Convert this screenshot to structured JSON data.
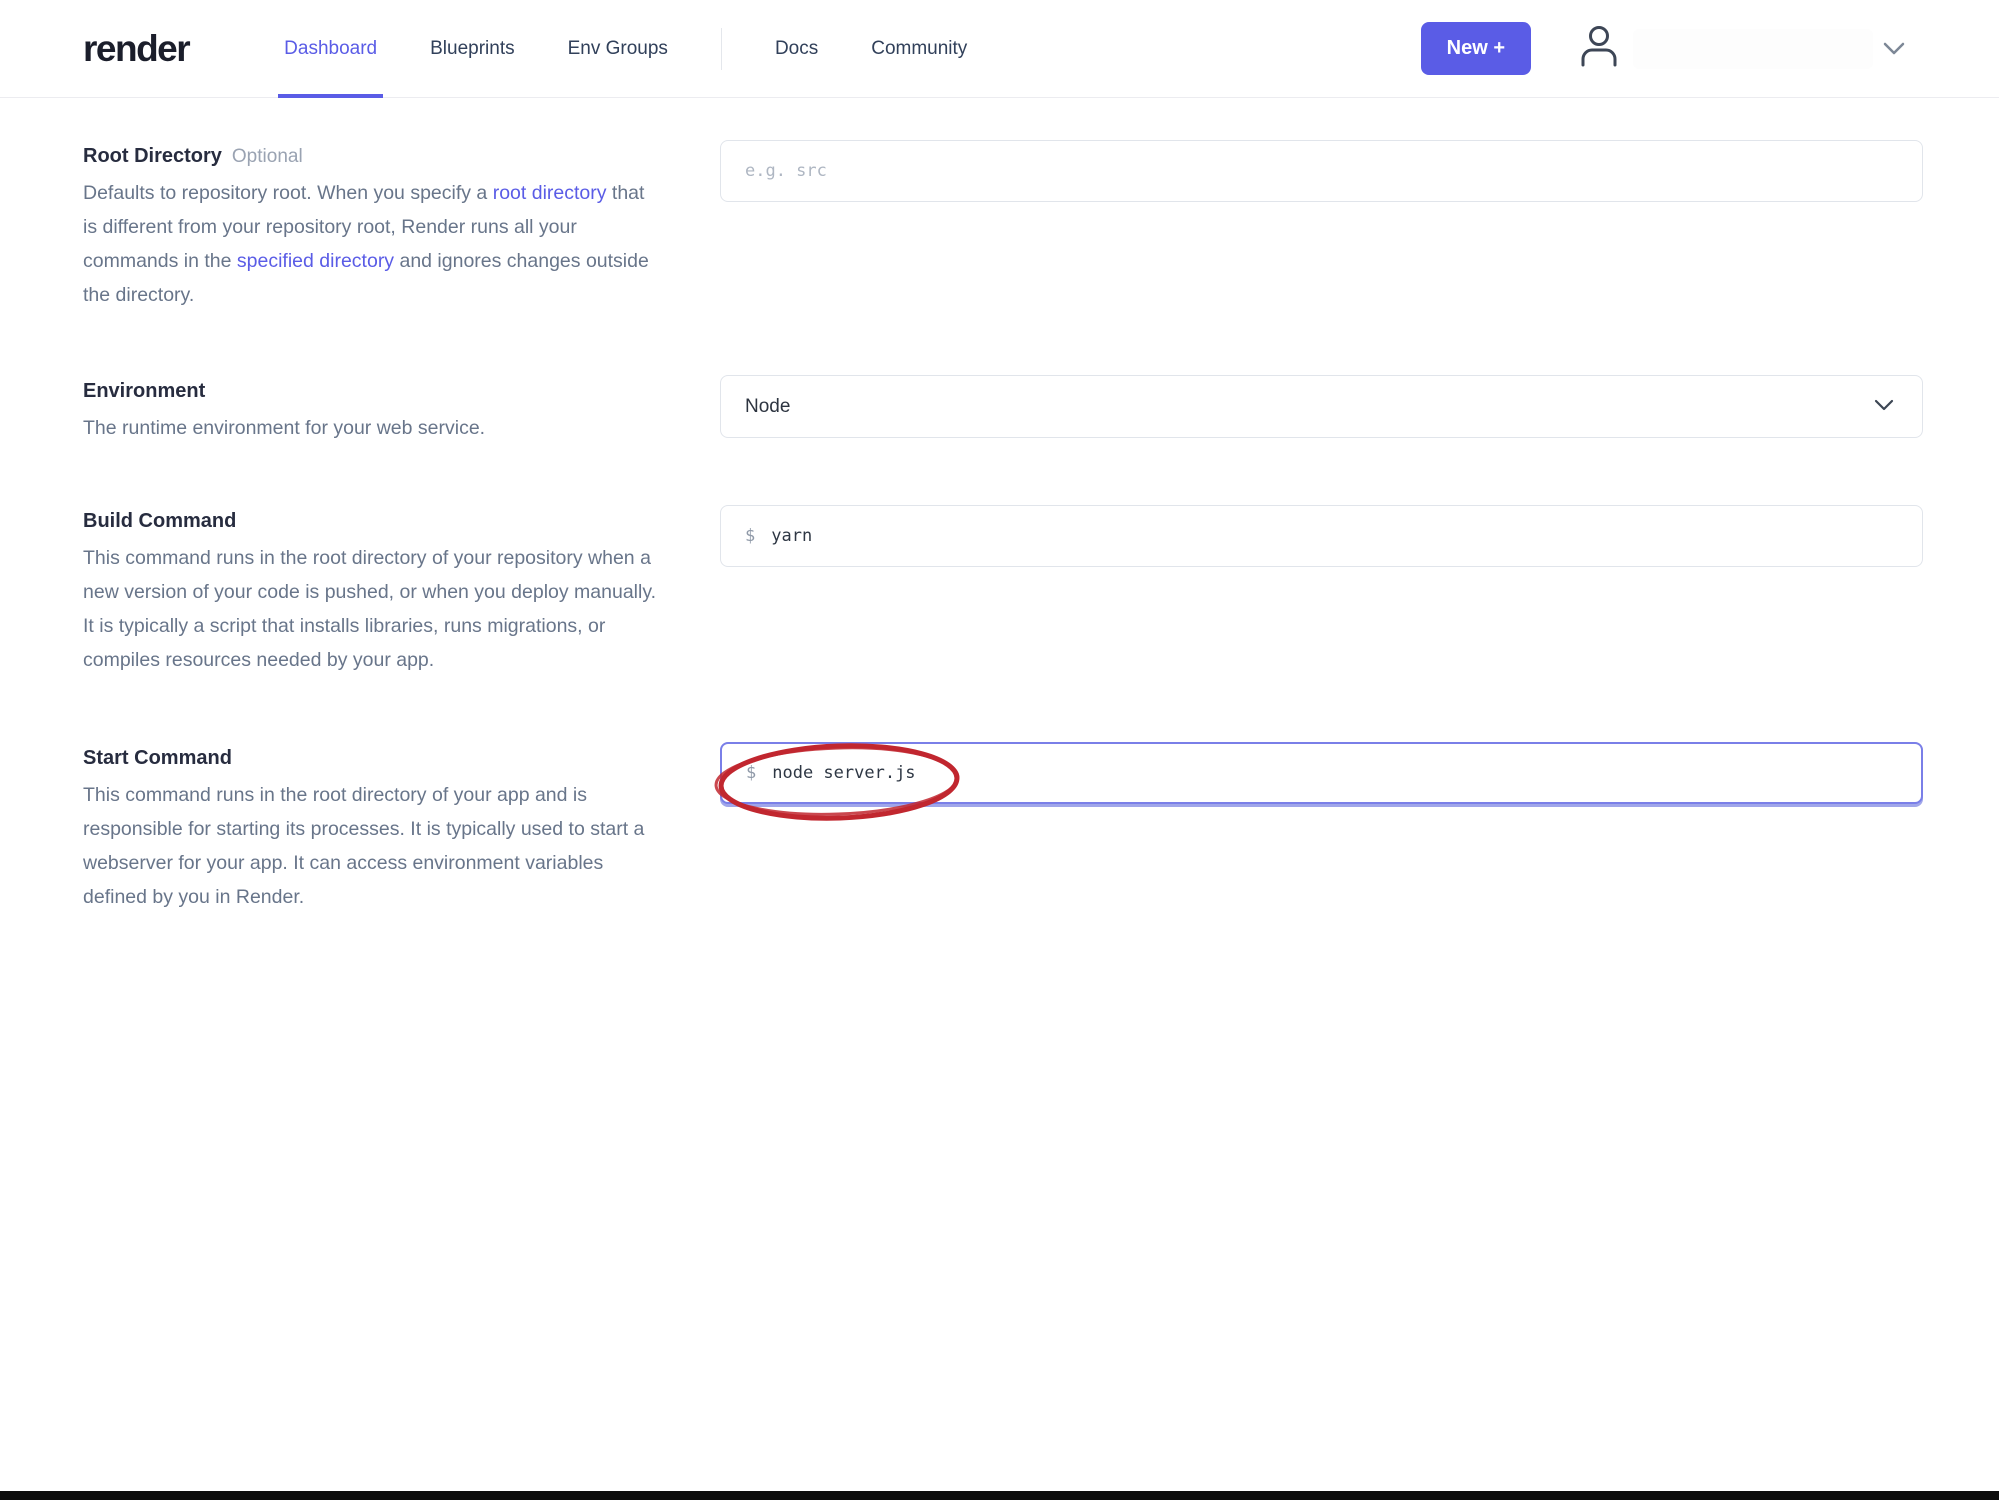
{
  "header": {
    "logo": "render",
    "nav": {
      "dashboard": "Dashboard",
      "blueprints": "Blueprints",
      "env_groups": "Env Groups",
      "docs": "Docs",
      "community": "Community"
    },
    "new_button_label": "New +"
  },
  "form": {
    "root_directory": {
      "label": "Root Directory",
      "badge": "Optional",
      "description_segments": [
        {
          "text": "Defaults to repository root. When you specify a "
        },
        {
          "text": "root directory",
          "link": true
        },
        {
          "text": " that is different from your repository root, Render runs all your commands in the "
        },
        {
          "text": "specified directory",
          "link": true
        },
        {
          "text": " and ignores changes outside the directory."
        }
      ],
      "placeholder": "e.g. src",
      "value": ""
    },
    "environment": {
      "label": "Environment",
      "description": "The runtime environment for your web service.",
      "selected": "Node"
    },
    "build_command": {
      "label": "Build Command",
      "description": "This command runs in the root directory of your repository when a new version of your code is pushed, or when you deploy manually. It is typically a script that installs libraries, runs migrations, or compiles resources needed by your app.",
      "prompt": "$",
      "value": "yarn"
    },
    "start_command": {
      "label": "Start Command",
      "description": "This command runs in the root directory of your app and is responsible for starting its processes. It is typically used to start a webserver for your app. It can access environment variables defined by you in Render.",
      "prompt": "$",
      "value": "node server.js",
      "annotation": "red-circle-highlight"
    }
  },
  "colors": {
    "accent": "#5A5CE6",
    "text_dark": "#272C3F",
    "text_muted": "#68758A",
    "input_border": "#E1E5EB",
    "focus_border": "#7A7FE8",
    "annotation_red": "#C1272F",
    "bottom_bar": "#0C0C0C"
  }
}
